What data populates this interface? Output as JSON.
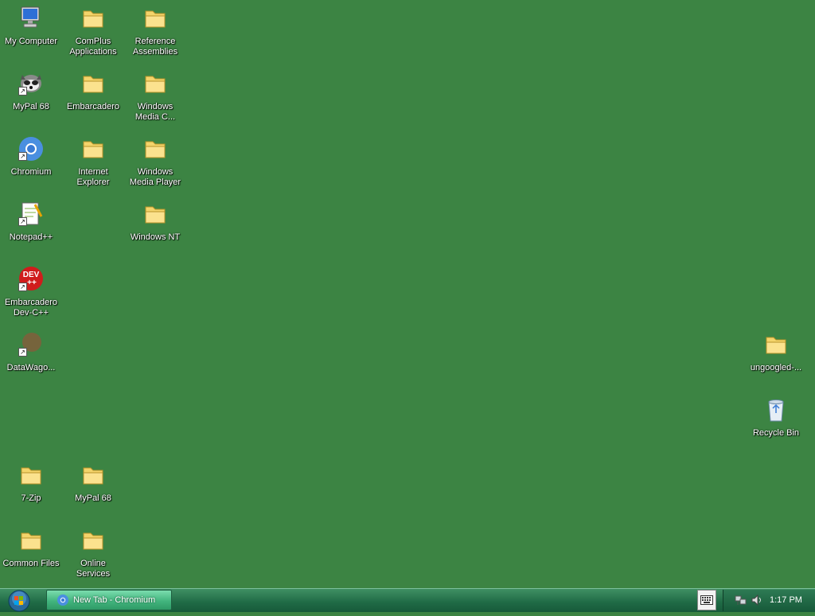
{
  "desktop": {
    "icons": [
      {
        "id": "my-computer",
        "label": "My Computer",
        "icon": "computer-icon"
      },
      {
        "id": "complus",
        "label": "ComPlus Applications",
        "icon": "folder-icon"
      },
      {
        "id": "reference-assemblies",
        "label": "Reference Assemblies",
        "icon": "folder-icon"
      },
      {
        "id": "mypal-shortcut",
        "label": "MyPal 68",
        "icon": "mypal-icon"
      },
      {
        "id": "embarcadero-folder",
        "label": "Embarcadero",
        "icon": "folder-icon"
      },
      {
        "id": "windows-media-c",
        "label": "Windows Media C...",
        "icon": "folder-icon"
      },
      {
        "id": "chromium",
        "label": "Chromium",
        "icon": "chromium-icon"
      },
      {
        "id": "internet-explorer",
        "label": "Internet Explorer",
        "icon": "folder-icon"
      },
      {
        "id": "windows-media-player",
        "label": "Windows Media Player",
        "icon": "folder-icon"
      },
      {
        "id": "notepadpp",
        "label": "Notepad++",
        "icon": "notepadpp-icon"
      },
      {
        "id": "windows-nt",
        "label": "Windows NT",
        "icon": "folder-icon"
      },
      {
        "id": "embarcadero-devcpp",
        "label": "Embarcadero Dev-C++",
        "icon": "devcpp-icon"
      },
      {
        "id": "datawago",
        "label": "DataWago...",
        "icon": "datawago-icon"
      },
      {
        "id": "ungoogled",
        "label": "ungoogled-...",
        "icon": "folder-icon"
      },
      {
        "id": "recycle-bin",
        "label": "Recycle Bin",
        "icon": "recycle-bin-icon"
      },
      {
        "id": "seven-zip",
        "label": "7-Zip",
        "icon": "folder-icon"
      },
      {
        "id": "mypal-folder",
        "label": "MyPal 68",
        "icon": "folder-icon"
      },
      {
        "id": "common-files",
        "label": "Common Files",
        "icon": "folder-icon"
      },
      {
        "id": "online-services",
        "label": "Online Services",
        "icon": "folder-icon"
      }
    ]
  },
  "taskbar": {
    "start_icon": "windows-orb-icon",
    "task": {
      "label": "New Tab - Chromium",
      "icon": "chromium-icon"
    },
    "keyboard_icon": "keyboard-icon",
    "tray_icons": [
      "network-icon",
      "volume-icon"
    ],
    "clock": "1:17 PM"
  },
  "colors": {
    "desktop_bg": "#3c8443",
    "taskbar": "#1f6a45",
    "folder": "#f4d46b"
  }
}
